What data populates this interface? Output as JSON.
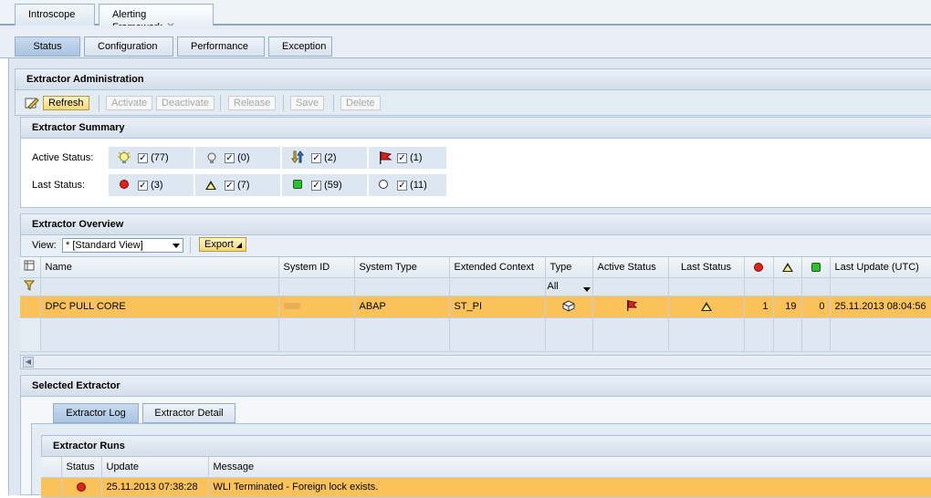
{
  "top_tabs": [
    {
      "label": "Introscope"
    },
    {
      "label": "Alerting Framework"
    }
  ],
  "sub_tabs": [
    {
      "label": "Status"
    },
    {
      "label": "Configuration"
    },
    {
      "label": "Performance"
    },
    {
      "label": "Exception"
    }
  ],
  "admin": {
    "title": "Extractor Administration",
    "toolbar": {
      "refresh": "Refresh",
      "activate": "Activate",
      "deactivate": "Deactivate",
      "release": "Release",
      "save": "Save",
      "delete": "Delete"
    }
  },
  "summary": {
    "title": "Extractor Summary",
    "active_label": "Active Status:",
    "last_label": "Last Status:",
    "active_counts": [
      "(77)",
      "(0)",
      "(2)",
      "(1)"
    ],
    "last_counts": [
      "(3)",
      "(7)",
      "(59)",
      "(11)"
    ],
    "check_mark": "✓"
  },
  "overview": {
    "title": "Extractor Overview",
    "view_label": "View:",
    "view_value": "* [Standard View]",
    "export": "Export",
    "columns": {
      "name": "Name",
      "system_id": "System ID",
      "system_type": "System Type",
      "ext_context": "Extended Context",
      "type": "Type",
      "active_status": "Active Status",
      "last_status": "Last Status",
      "last_update": "Last Update (UTC)"
    },
    "type_filter": "All",
    "rows": [
      {
        "name": "DPC PULL CORE",
        "system_type": "ABAP",
        "ext_context": "ST_PI",
        "red": "1",
        "yellow": "19",
        "green": "0",
        "last_update": "25.11.2013 08:04:56"
      }
    ]
  },
  "selected": {
    "title": "Selected Extractor",
    "tabs": {
      "log": "Extractor Log",
      "detail": "Extractor Detail"
    },
    "runs_title": "Extractor Runs",
    "columns": {
      "status": "Status",
      "update": "Update",
      "message": "Message"
    },
    "rows": [
      {
        "update": "25.11.2013 07:38:28",
        "message": "WLI Terminated - Foreign lock exists."
      }
    ]
  }
}
